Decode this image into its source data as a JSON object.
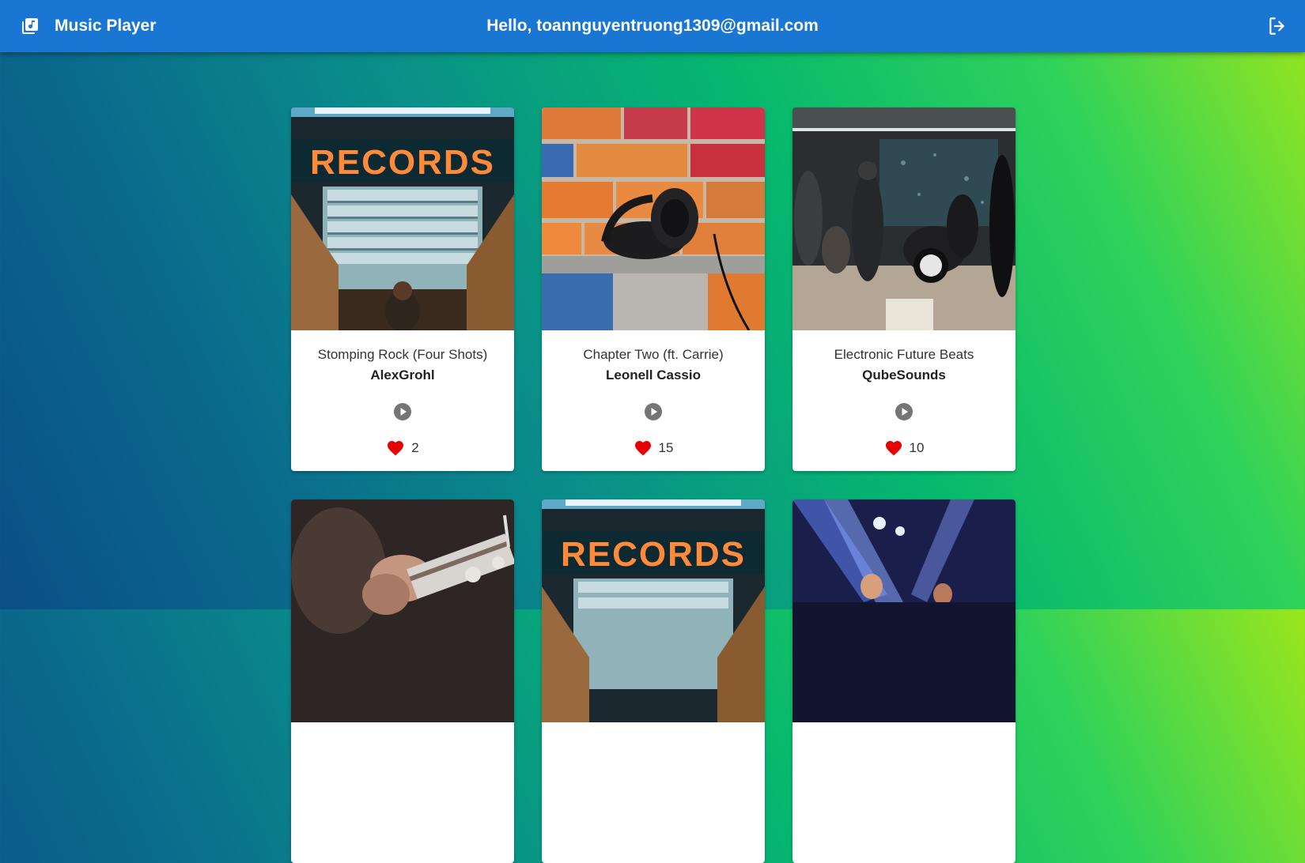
{
  "header": {
    "app_title": "Music Player",
    "greeting": "Hello, toannguyentruong1309@gmail.com",
    "icons": {
      "logo": "library-music-icon",
      "logout": "logout-icon"
    }
  },
  "songs": [
    {
      "title": "Stomping Rock (Four Shots)",
      "artist": "AlexGrohl",
      "likes": "2",
      "cover": "records-store-photo"
    },
    {
      "title": "Chapter Two (ft. Carrie)",
      "artist": "Leonell Cassio",
      "likes": "15",
      "cover": "headphones-on-brick-wall-photo"
    },
    {
      "title": "Electronic Future Beats",
      "artist": "QubeSounds",
      "likes": "10",
      "cover": "band-rehearsal-photo"
    },
    {
      "cover": "guitar-closeup-photo"
    },
    {
      "cover": "records-store-photo"
    },
    {
      "cover": "concert-stage-lights-photo"
    }
  ],
  "colors": {
    "appbar": "#1976d2",
    "heart": "#e60000",
    "play": "#757575"
  }
}
